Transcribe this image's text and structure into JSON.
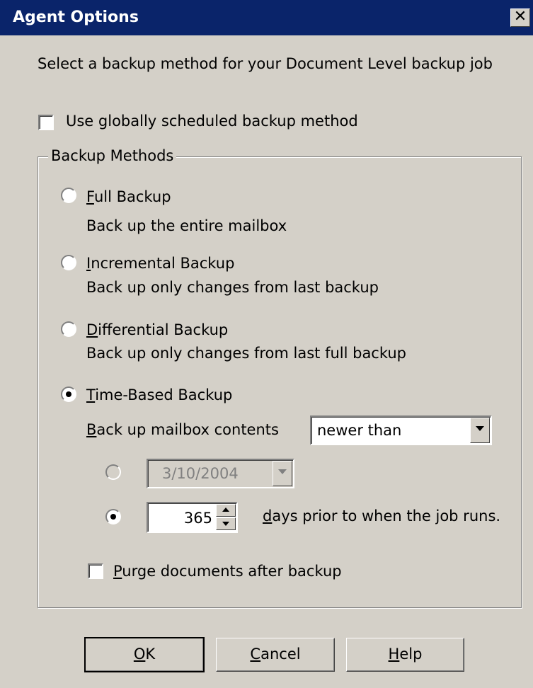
{
  "window": {
    "title": "Agent Options",
    "close_glyph": "✕"
  },
  "prompt": "Select a backup method for your Document Level backup job",
  "use_global": {
    "label": "Use globally scheduled backup method",
    "checked": false
  },
  "group_title": "Backup Methods",
  "methods": [
    {
      "key": "F",
      "rest": "ull Backup",
      "desc": "Back up the entire mailbox",
      "selected": false
    },
    {
      "key": "I",
      "rest": "ncremental Backup",
      "desc": "Back up only changes from last backup",
      "selected": false
    },
    {
      "key": "D",
      "rest": "ifferential Backup",
      "desc": "Back up only changes from last full backup",
      "selected": false
    },
    {
      "key": "T",
      "rest": "ime-Based Backup",
      "desc": "",
      "selected": true
    }
  ],
  "time_based": {
    "contents_key": "B",
    "contents_rest": "ack up mailbox contents",
    "comparison": "newer than",
    "date_value": "3/10/2004",
    "days_value": "365",
    "days_key": "d",
    "days_rest": "ays prior to when the job runs."
  },
  "purge": {
    "key": "P",
    "rest": "urge documents after backup",
    "checked": false
  },
  "buttons": {
    "ok_key": "O",
    "ok_rest": "K",
    "cancel_key": "C",
    "cancel_rest": "ancel",
    "help_key": "H",
    "help_rest": "elp"
  }
}
